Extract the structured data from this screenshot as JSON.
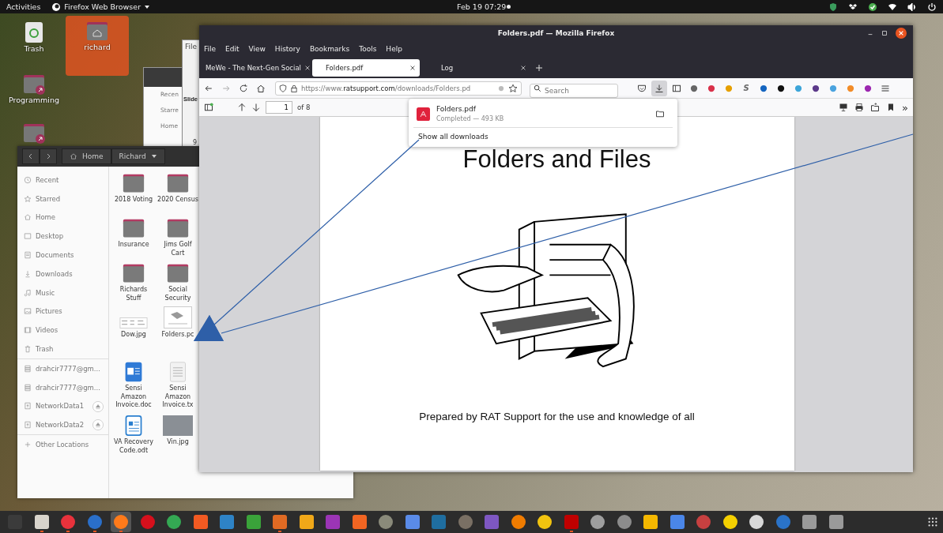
{
  "top_bar": {
    "activities": "Activities",
    "app_menu": "Firefox Web Browser",
    "clock": "Feb 19 07:29",
    "tray": [
      {
        "kind": "shield"
      },
      {
        "kind": "box"
      },
      {
        "kind": "check"
      },
      {
        "kind": "wifi"
      },
      {
        "kind": "volume"
      },
      {
        "kind": "power"
      }
    ]
  },
  "desktop_icons": [
    {
      "label": "Trash",
      "kind": "trash",
      "selected": false
    },
    {
      "label": "richard",
      "kind": "home",
      "selected": true
    },
    {
      "label": "Programming",
      "kind": "link-folder",
      "selected": false
    },
    {
      "kind": "link-folder",
      "selected": false
    }
  ],
  "back_windows": {
    "menu": "File",
    "slide_label": "Slide",
    "sidebar": [
      "Recen",
      "Starre",
      "Home"
    ],
    "digit": "9"
  },
  "files_window": {
    "path": [
      {
        "label": "Home",
        "kind": "home"
      },
      {
        "label": "Richard",
        "kind": "dropdown"
      }
    ],
    "sidebar": [
      {
        "label": "Recent",
        "eject": false
      },
      {
        "label": "Starred",
        "eject": false
      },
      {
        "label": "Home",
        "eject": false
      },
      {
        "label": "Desktop",
        "eject": false
      },
      {
        "label": "Documents",
        "eject": false
      },
      {
        "label": "Downloads",
        "eject": false
      },
      {
        "label": "Music",
        "eject": false
      },
      {
        "label": "Pictures",
        "eject": false
      },
      {
        "label": "Videos",
        "eject": false
      },
      {
        "label": "Trash",
        "eject": false
      },
      {
        "label": "drahcir7777@gm...",
        "eject": false
      },
      {
        "label": "drahcir7777@gm...",
        "eject": false
      },
      {
        "label": "NetworkData1",
        "eject": true
      },
      {
        "label": "NetworkData2",
        "eject": true
      },
      {
        "label": "Other Locations",
        "eject": false
      }
    ],
    "files": [
      {
        "name": "2018 Voting",
        "kind": "folder"
      },
      {
        "name": "2020 Census",
        "kind": "folder"
      },
      {
        "name": "Insurance",
        "kind": "folder"
      },
      {
        "name": "Jims Golf Cart",
        "kind": "folder"
      },
      {
        "name": "Richards Stuff",
        "kind": "folder"
      },
      {
        "name": "Social Security",
        "kind": "folder"
      },
      {
        "name": "Dow.jpg",
        "kind": "image"
      },
      {
        "name": "Folders.pc",
        "kind": "pdf"
      },
      {
        "name": "Sensi Amazon Invoice.doc",
        "kind": "doc"
      },
      {
        "name": "Sensi Amazon Invoice.tx",
        "kind": "text"
      },
      {
        "name": "VA Recovery Code.odt",
        "kind": "odt"
      },
      {
        "name": "Vin.jpg",
        "kind": "photo"
      }
    ]
  },
  "firefox": {
    "title": "Folders.pdf — Mozilla Firefox",
    "menu": [
      "File",
      "Edit",
      "View",
      "History",
      "Bookmarks",
      "Tools",
      "Help"
    ],
    "tabs": [
      {
        "label": "MeWe - The Next-Gen Social",
        "selected": false
      },
      {
        "label": "Folders.pdf",
        "selected": true
      },
      {
        "label": "Log",
        "selected": false
      }
    ],
    "url_prefix": "https://www.",
    "url_domain": "ratsupport.com",
    "url_rest": "/downloads/Folders.pd",
    "search_placeholder": "Search",
    "toolbar_icons": [
      {
        "kind": "pocket",
        "selected": false
      },
      {
        "kind": "download",
        "selected": true
      },
      {
        "kind": "sidebar",
        "selected": false
      },
      {
        "kind": "dot",
        "color": "#666666",
        "selected": false
      },
      {
        "kind": "dot",
        "color": "#d9314a",
        "selected": false
      },
      {
        "kind": "dot",
        "color": "#e6a000",
        "selected": false
      },
      {
        "kind": "glyph",
        "glyph": "S",
        "selected": false
      },
      {
        "kind": "dot",
        "color": "#1565c0",
        "selected": false
      },
      {
        "kind": "dot",
        "color": "#111111",
        "selected": false
      },
      {
        "kind": "dot",
        "color": "#3da5d9",
        "selected": false
      },
      {
        "kind": "dot",
        "color": "#5c3a8a",
        "selected": false
      },
      {
        "kind": "dot",
        "color": "#4aa3df",
        "selected": false
      },
      {
        "kind": "dot",
        "color": "#f28c28",
        "selected": false
      },
      {
        "kind": "dot",
        "color": "#9c27b0",
        "selected": false
      },
      {
        "kind": "menu",
        "selected": false
      }
    ],
    "pdf": {
      "page": "1",
      "page_count": "of 8",
      "more": "»",
      "heading": "Folders and Files",
      "caption": "Prepared by RAT Support for the use and knowledge of all"
    },
    "download": {
      "file": "Folders.pdf",
      "status": "Completed — 493 KB",
      "show_all": "Show all downloads"
    }
  },
  "dock": [
    {
      "color": "#3b3b3b",
      "running": false,
      "selected": false
    },
    {
      "color": "#d8d4cc",
      "running": true,
      "selected": false
    },
    {
      "color": "#e8323c",
      "running": true,
      "selected": false
    },
    {
      "color": "#2a6fc9",
      "running": true,
      "selected": false
    },
    {
      "color": "#ff7a1a",
      "running": true,
      "selected": true
    },
    {
      "color": "#d6101c",
      "running": false,
      "selected": false
    },
    {
      "color": "#34a853",
      "running": false,
      "selected": false
    },
    {
      "color": "#f25a22",
      "running": false,
      "selected": false
    },
    {
      "color": "#2e83c6",
      "running": false,
      "selected": false
    },
    {
      "color": "#3aa33a",
      "running": false,
      "selected": false
    },
    {
      "color": "#e06a23",
      "running": true,
      "selected": false
    },
    {
      "color": "#f0a818",
      "running": false,
      "selected": false
    },
    {
      "color": "#9b35b5",
      "running": false,
      "selected": false
    },
    {
      "color": "#f26522",
      "running": false,
      "selected": false
    },
    {
      "color": "#8a8a7a",
      "running": false,
      "selected": false
    },
    {
      "color": "#5a8be8",
      "running": false,
      "selected": false
    },
    {
      "color": "#1f6ea0",
      "running": false,
      "selected": false
    },
    {
      "color": "#7a7064",
      "running": false,
      "selected": false
    },
    {
      "color": "#7e57c2",
      "running": false,
      "selected": false
    },
    {
      "color": "#f07c00",
      "running": false,
      "selected": false
    },
    {
      "color": "#f2c40f",
      "running": false,
      "selected": false
    },
    {
      "color": "#bf0000",
      "running": true,
      "selected": false
    },
    {
      "color": "#9e9e9e",
      "running": false,
      "selected": false
    },
    {
      "color": "#8c8c8c",
      "running": false,
      "selected": false
    },
    {
      "color": "#f5b800",
      "running": false,
      "selected": false
    },
    {
      "color": "#4a86e8",
      "running": false,
      "selected": false
    },
    {
      "color": "#c74040",
      "running": false,
      "selected": false
    },
    {
      "color": "#f5d000",
      "running": false,
      "selected": false
    },
    {
      "color": "#d8d8d8",
      "running": false,
      "selected": false
    },
    {
      "color": "#2a73c8",
      "running": false,
      "selected": false
    },
    {
      "color": "#9a9a9a",
      "running": false,
      "selected": false
    },
    {
      "color": "#9a9a9a",
      "running": false,
      "selected": false
    }
  ]
}
